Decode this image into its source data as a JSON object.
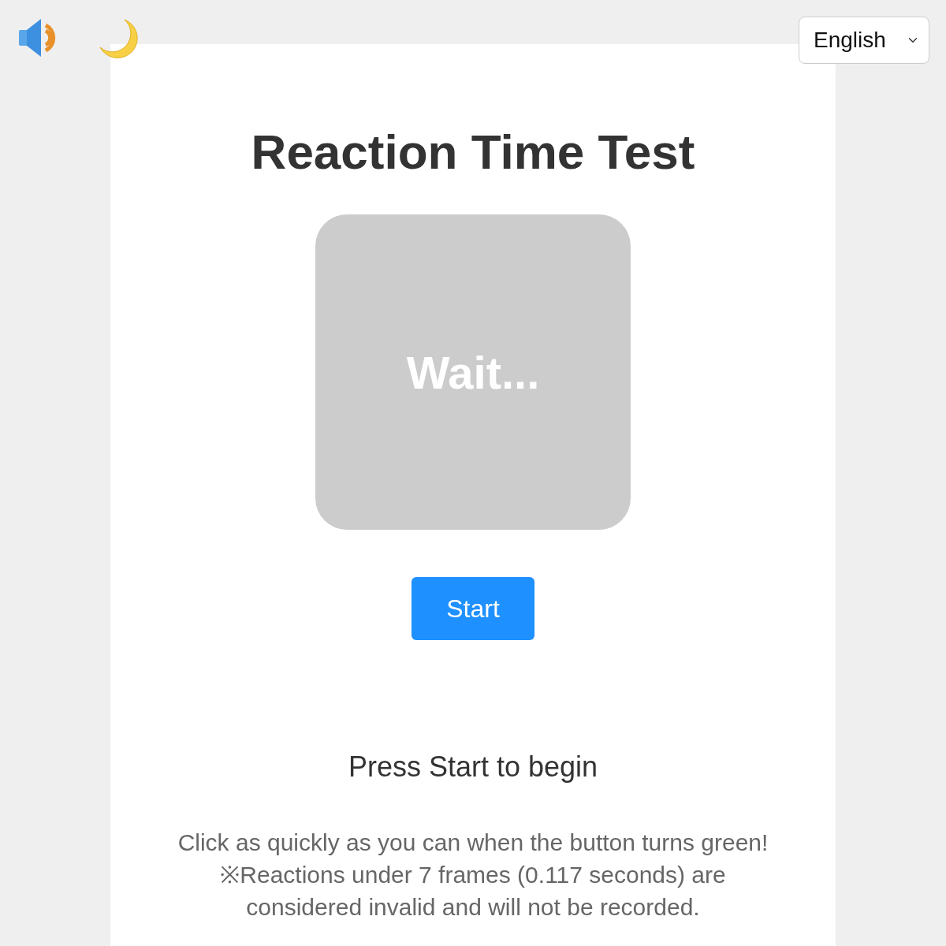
{
  "language_select": {
    "value": "English"
  },
  "title": "Reaction Time Test",
  "target": {
    "label": "Wait..."
  },
  "start_button": "Start",
  "status": "Press Start to begin",
  "instructions": [
    "Click as quickly as you can when the button turns green!",
    "※Reactions under 7 frames (0.117 seconds) are considered invalid and will not be recorded."
  ]
}
